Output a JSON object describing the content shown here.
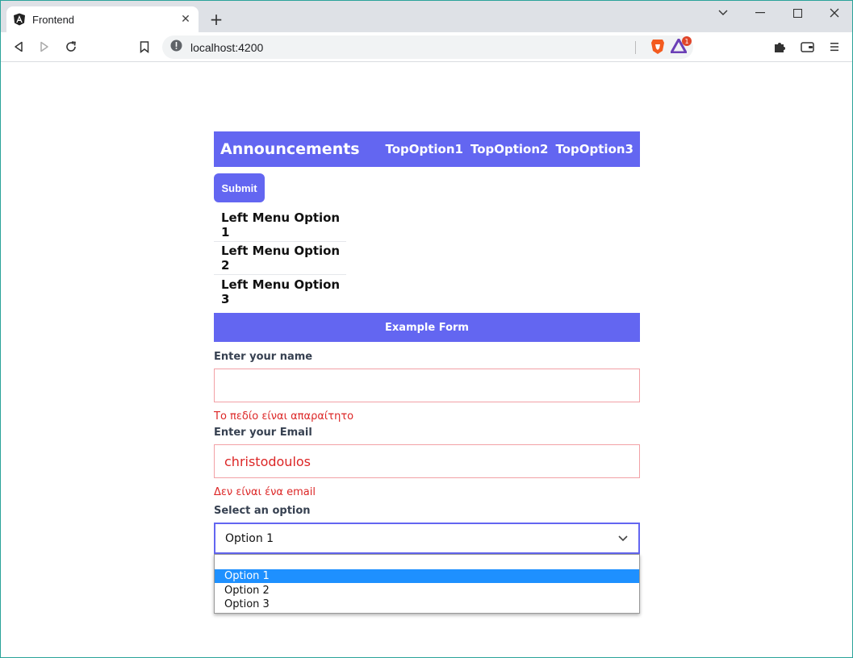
{
  "browser": {
    "tab_title": "Frontend",
    "url": "localhost:4200",
    "rewards_count": "1"
  },
  "app": {
    "brand": "Announcements",
    "top_options": [
      "TopOption1",
      "TopOption2",
      "TopOption3"
    ],
    "submit_label": "Submit",
    "left_menu": [
      "Left Menu Option 1",
      "Left Menu Option 2",
      "Left Menu Option 3"
    ],
    "accent_color": "#6366f1"
  },
  "form": {
    "header": "Example Form",
    "name_label": "Enter your name",
    "name_value": "",
    "name_error": "Το πεδίο είναι απαραίτητο",
    "email_label": "Enter your Email",
    "email_value": "christodoulos",
    "email_error": "Δεν είναι ένα email",
    "select_label": "Select an option",
    "select_value": "Option 1",
    "select_options": [
      "Option 1",
      "Option 2",
      "Option 3"
    ],
    "error_color": "#dc2626"
  }
}
